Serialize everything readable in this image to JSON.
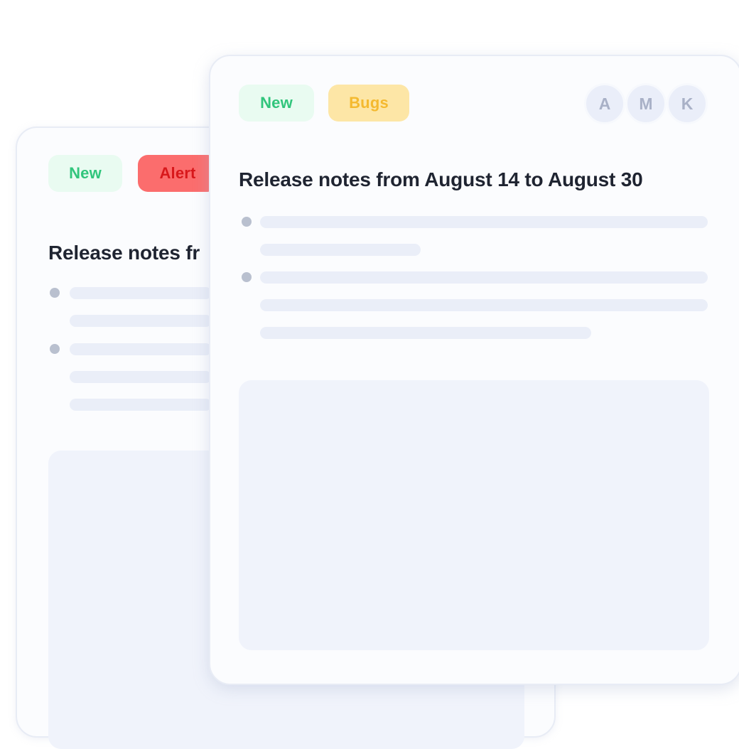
{
  "back_card": {
    "tags": {
      "new": "New",
      "alert": "Alert"
    },
    "title": "Release notes fr"
  },
  "front_card": {
    "tags": {
      "new": "New",
      "bugs": "Bugs"
    },
    "avatars": [
      "A",
      "M",
      "K"
    ],
    "title": "Release notes from August 14 to August 30"
  },
  "colors": {
    "new_tag_bg": "#e9fbf1",
    "new_tag_text": "#31c57c",
    "alert_tag_bg": "#fb6d6d",
    "alert_tag_text": "#d8181b",
    "bugs_tag_bg": "#fde6a6",
    "bugs_tag_text": "#f4b92f",
    "placeholder": "#eaeef8"
  }
}
